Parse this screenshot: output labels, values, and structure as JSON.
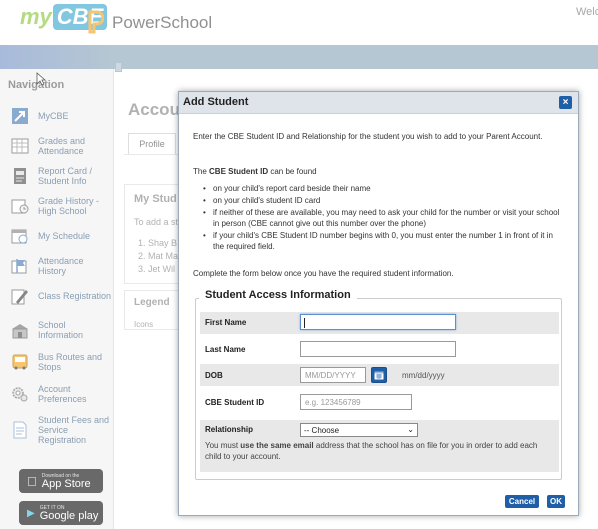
{
  "header": {
    "brand_my": "my",
    "brand_cbe": "CBE",
    "app_name": "PowerSchool",
    "welcome": "Welc"
  },
  "sidebar": {
    "title": "Navigation",
    "items": [
      {
        "label": "MyCBE",
        "icon": "arrow-link-icon"
      },
      {
        "label": "Grades and Attendance",
        "icon": "grades-grid-icon"
      },
      {
        "label": "Report Card / Student Info",
        "icon": "report-card-icon"
      },
      {
        "label": "Grade History - High School",
        "icon": "grade-history-icon"
      },
      {
        "label": "My Schedule",
        "icon": "calendar-clock-icon"
      },
      {
        "label": "Attendance History",
        "icon": "attendance-flag-icon"
      },
      {
        "label": "Class Registration",
        "icon": "registration-pencil-icon"
      },
      {
        "label": "School Information",
        "icon": "school-building-icon"
      },
      {
        "label": "Bus Routes and Stops",
        "icon": "bus-icon"
      },
      {
        "label": "Account Preferences",
        "icon": "gears-icon"
      },
      {
        "label": "Student Fees and Service Registration",
        "icon": "fees-document-icon"
      }
    ],
    "app_store": {
      "small": "Download on the",
      "big": "App Store"
    },
    "google_play": {
      "small": "GET IT ON",
      "big": "Google play"
    }
  },
  "background_page": {
    "title": "Accou",
    "tab_profile": "Profile",
    "students_heading": "My Stud",
    "students_intro": "To add a st",
    "students": [
      "1. Shay B",
      "2. Mat Ma",
      "3. Jet Wil"
    ],
    "legend_heading": "Legend",
    "legend_icons": "Icons"
  },
  "modal": {
    "title": "Add Student",
    "close_label": "×",
    "intro": "Enter the CBE Student ID and Relationship for the student you wish to add to your Parent Account.",
    "found_prefix": "The ",
    "found_bold": "CBE Student ID",
    "found_suffix": " can be found",
    "bullets": [
      "on your child's report card beside their name",
      "on your child's student ID card",
      "if neither of these are available, you may need to ask your child for the number or visit your school in person (CBE cannot give out this number over the phone)",
      "if your child's CBE Student ID number begins with 0, you must enter the number 1 in front of it in the required field."
    ],
    "complete_text": "Complete the form below once you have the required student information.",
    "section_title": "Student Access Information",
    "fields": {
      "first_name_label": "First Name",
      "first_name_value": "",
      "last_name_label": "Last Name",
      "last_name_value": "",
      "dob_label": "DOB",
      "dob_placeholder": "MM/DD/YYYY",
      "dob_hint": "mm/dd/yyyy",
      "student_id_label": "CBE Student ID",
      "student_id_placeholder": "e.g. 123456789",
      "relationship_label": "Relationship",
      "relationship_selected": "-- Choose",
      "email_note_prefix": "You must ",
      "email_note_bold": "use the same email",
      "email_note_suffix": " address that the school has on file for you in order to add each child to your account."
    },
    "cancel_label": "Cancel",
    "ok_label": "OK"
  },
  "colors": {
    "accent_blue": "#1f5fa8",
    "brand_green": "#8dc63f",
    "topbar": "#8da9bb"
  }
}
